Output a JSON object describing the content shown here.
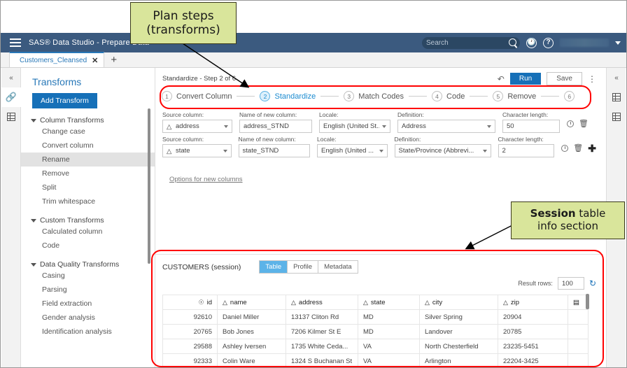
{
  "window": {
    "app_title": "SAS® Data Studio - Prepare Data",
    "menu_icon": "hamburger-icon"
  },
  "topbar": {
    "search_placeholder": "Search",
    "search_icon": "search-icon",
    "history_icon": "clock-history-icon",
    "help_icon": "help-icon",
    "user_menu_caret": "chevron-down-icon"
  },
  "tabs": {
    "items": [
      {
        "label": "Customers_Cleansed",
        "close": "✕"
      }
    ],
    "add_label": "+"
  },
  "left_rail": {
    "collapse_label": "«",
    "items": [
      {
        "name": "plan-icon"
      },
      {
        "name": "table-icon"
      }
    ]
  },
  "right_rail": {
    "collapse_label": "«",
    "items": [
      {
        "name": "properties-icon"
      },
      {
        "name": "table-details-icon"
      }
    ]
  },
  "transforms_panel": {
    "title": "Transforms",
    "add_button": "Add Transform",
    "groups": [
      {
        "label": "Column Transforms",
        "items": [
          "Change case",
          "Convert column",
          "Rename",
          "Remove",
          "Split",
          "Trim whitespace"
        ]
      },
      {
        "label": "Custom Transforms",
        "items": [
          "Calculated column",
          "Code"
        ]
      },
      {
        "label": "Data Quality Transforms",
        "items": [
          "Casing",
          "Parsing",
          "Field extraction",
          "Gender analysis",
          "Identification analysis"
        ]
      }
    ],
    "selected_item": "Rename"
  },
  "step_header": {
    "label": "Standardize - Step 2 of 6",
    "undo_icon": "undo-icon",
    "run_button": "Run",
    "save_button": "Save",
    "more_icon": "kebab-menu-icon"
  },
  "plan_steps": [
    {
      "number": "1",
      "label": "Convert Column",
      "current": false
    },
    {
      "number": "2",
      "label": "Standardize",
      "current": true
    },
    {
      "number": "3",
      "label": "Match Codes",
      "current": false
    },
    {
      "number": "4",
      "label": "Code",
      "current": false
    },
    {
      "number": "5",
      "label": "Remove",
      "current": false
    },
    {
      "number": "6",
      "label": "",
      "current": false
    }
  ],
  "form": {
    "labels": {
      "source_column": "Source column:",
      "new_column_name": "Name of new column:",
      "locale": "Locale:",
      "definition": "Definition:",
      "character_length": "Character length:"
    },
    "rows": [
      {
        "source_column": "address",
        "new_column_name": "address_STND",
        "locale": "English (United St...",
        "definition": "Address",
        "character_length": "50",
        "icons": [
          "clock-icon",
          "trash-icon"
        ]
      },
      {
        "source_column": "state",
        "new_column_name": "state_STND",
        "locale": "English (United ...",
        "definition": "State/Province (Abbrevi...",
        "character_length": "2",
        "icons": [
          "clock-icon",
          "trash-icon",
          "plus-icon"
        ]
      }
    ],
    "options_link": "Options for new columns"
  },
  "session": {
    "title": "CUSTOMERS (session)",
    "view_tabs": [
      {
        "label": "Table",
        "active": true
      },
      {
        "label": "Profile",
        "active": false
      },
      {
        "label": "Metadata",
        "active": false
      }
    ],
    "result_rows_label": "Result rows:",
    "result_rows_value": "100",
    "refresh_icon": "refresh-icon",
    "column_options_icon": "column-options-icon",
    "columns": [
      {
        "label": "id",
        "icon": "key-icon",
        "numeric": true
      },
      {
        "label": "name",
        "icon": "char-icon",
        "numeric": false
      },
      {
        "label": "address",
        "icon": "char-icon",
        "numeric": false
      },
      {
        "label": "state",
        "icon": "char-icon",
        "numeric": false
      },
      {
        "label": "city",
        "icon": "char-icon",
        "numeric": false
      },
      {
        "label": "zip",
        "icon": "char-icon",
        "numeric": false
      }
    ],
    "rows": [
      [
        "92610",
        "Daniel Miller",
        "13137 Cliton Rd",
        "MD",
        "Silver Spring",
        "20904"
      ],
      [
        "20765",
        "Bob Jones",
        "7206 Kilmer St E",
        "MD",
        "Landover",
        "20785"
      ],
      [
        "29588",
        "Ashley Iversen",
        "1735 White Ceda...",
        "VA",
        "North Chesterfield",
        "23235-5451"
      ],
      [
        "92333",
        "Colin Ware",
        "1324 S Buchanan St",
        "VA",
        "Arlington",
        "22204-3425"
      ]
    ]
  },
  "annotations": {
    "callout_1": {
      "line1": "Plan steps",
      "line2": "(transforms)"
    },
    "callout_2": {
      "line1_bold": "Session",
      "line1_rest": " table",
      "line2": "info section"
    },
    "highlight_color": "#ff0000",
    "callout_fill": "#d9e59b"
  }
}
